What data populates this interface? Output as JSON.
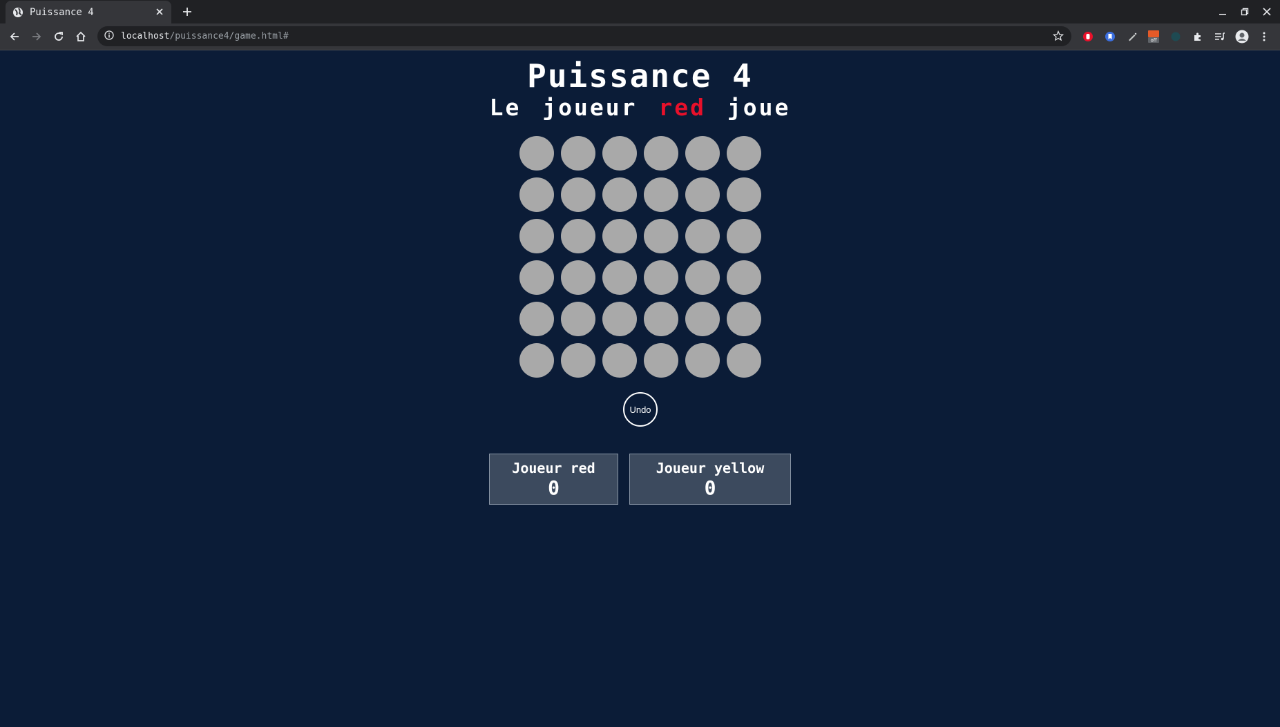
{
  "browser": {
    "tab_title": "Puissance 4",
    "url_host": "localhost",
    "url_path": "/puissance4/game.html#",
    "icons": [
      "back-icon",
      "forward-icon",
      "reload-icon",
      "home-icon",
      "info-icon",
      "star-icon",
      "extensions-icon",
      "menu-icon"
    ]
  },
  "game": {
    "title": "Puissance 4",
    "status_prefix": "Le joueur",
    "current_player": "red",
    "status_suffix": "joue",
    "board_rows": 6,
    "board_cols": 6,
    "empty_cell_color": "#a9a9a9",
    "undo_label": "Undo"
  },
  "scores": [
    {
      "label": "Joueur red",
      "value": "0"
    },
    {
      "label": "Joueur yellow",
      "value": "0"
    }
  ],
  "colors": {
    "background": "#0b1c37",
    "player_red": "#e8102a",
    "score_panel": "#3c4a5e"
  }
}
